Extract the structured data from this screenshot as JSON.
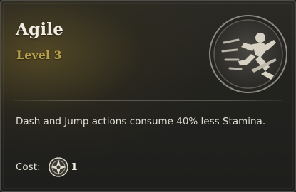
{
  "skill": {
    "name": "Agile",
    "level": "Level 3",
    "icon": "dashing-figure-icon",
    "description": "Dash and Jump actions consume 40% less Stamina."
  },
  "cost": {
    "label": "Cost:",
    "icon": "skill-point-emblem-icon",
    "value": "1"
  },
  "colors": {
    "title": "#f1ede3",
    "level": "#b7a04a",
    "text": "#e2ded4",
    "border": "#4d4c48"
  }
}
